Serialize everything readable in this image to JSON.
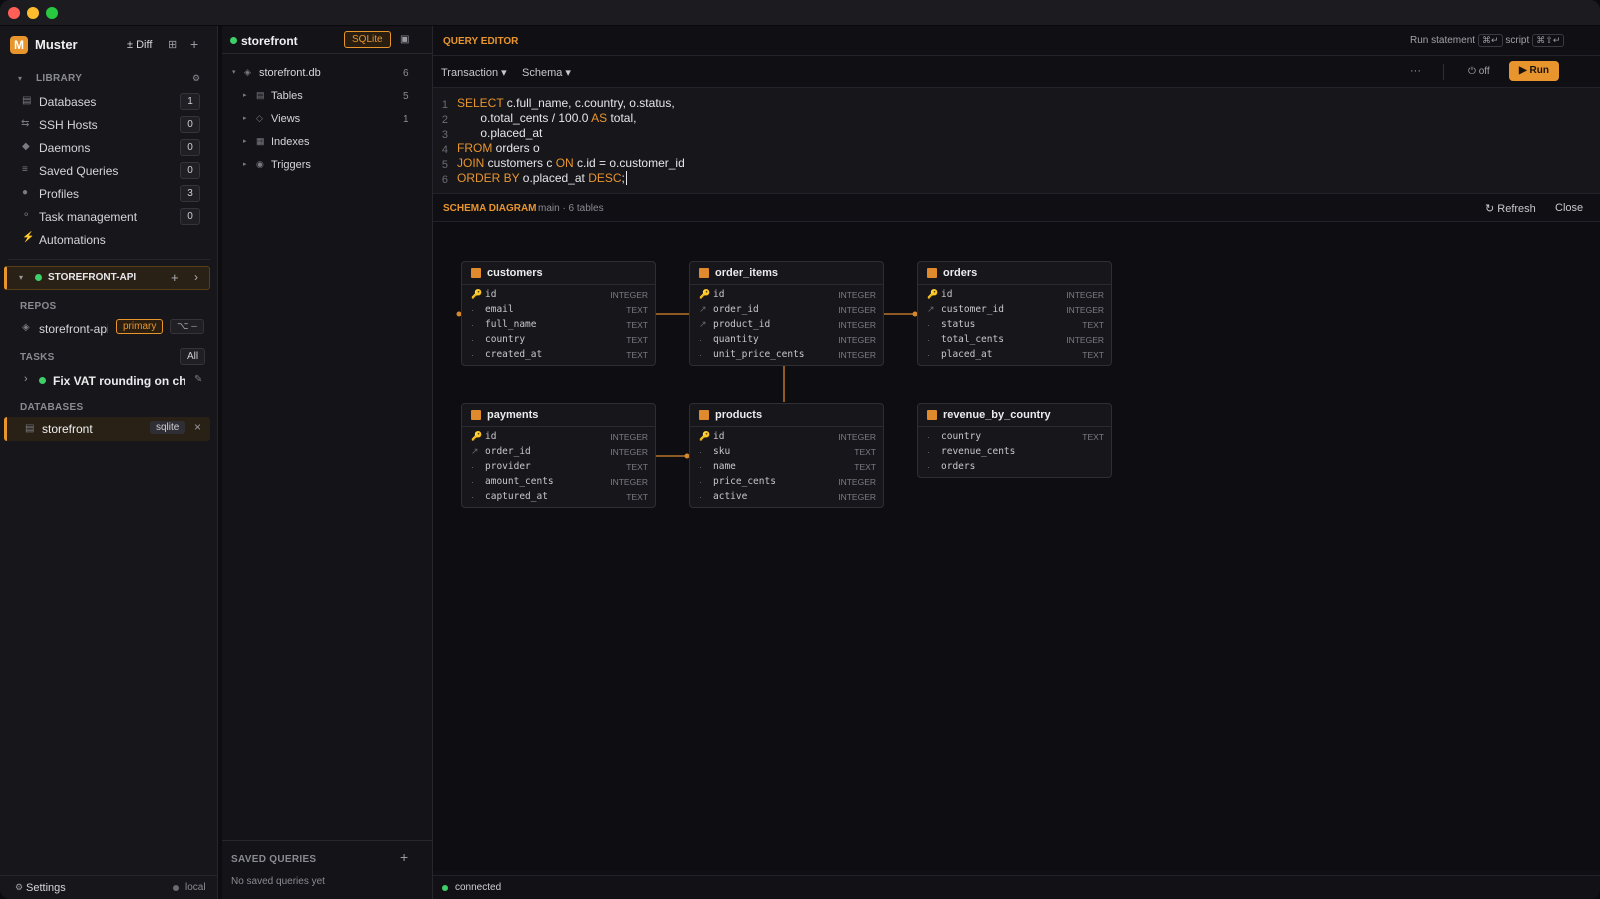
{
  "app": {
    "name": "Muster",
    "logo_letter": "M",
    "diff": "± Diff"
  },
  "library": {
    "title": "LIBRARY",
    "items": [
      {
        "label": "Databases",
        "count": "1"
      },
      {
        "label": "SSH Hosts",
        "count": "0"
      },
      {
        "label": "Daemons",
        "count": "0"
      },
      {
        "label": "Saved Queries",
        "count": "0"
      },
      {
        "label": "Profiles",
        "count": "3"
      },
      {
        "label": "Task management",
        "count": "0"
      },
      {
        "label": "Automations"
      }
    ]
  },
  "project": {
    "name": "STOREFRONT-API"
  },
  "repos": {
    "title": "REPOS",
    "name": "storefront-api",
    "badge": "primary",
    "branch_icon": "⌥ –"
  },
  "tasks": {
    "title": "TASKS",
    "filter": "All",
    "item": "Fix VAT rounding on checkout"
  },
  "databases": {
    "title": "DATABASES",
    "item": "storefront",
    "badge": "sqlite"
  },
  "footer": {
    "settings": "Settings",
    "local": "local"
  },
  "explorer": {
    "db_name": "storefront",
    "db_type": "SQLite",
    "file": "storefront.db",
    "file_count": "6",
    "nodes": [
      {
        "label": "Tables",
        "count": "5"
      },
      {
        "label": "Views",
        "count": "1"
      },
      {
        "label": "Indexes",
        "count": ""
      },
      {
        "label": "Triggers",
        "count": ""
      }
    ],
    "saved_title": "SAVED QUERIES",
    "saved_empty": "No saved queries yet"
  },
  "editor": {
    "title": "QUERY EDITOR",
    "run_statement": "Run statement",
    "kbd1": "⌘↵",
    "script": "script",
    "kbd2": "⌘⇧↵",
    "transaction": "Transaction ▾",
    "schema": "Schema ▾",
    "more": "···",
    "autocommit": "⏻ off",
    "run": "▶ Run",
    "line_numbers": [
      "1",
      "2",
      "3",
      "4",
      "5",
      "6"
    ]
  },
  "diagram": {
    "title": "SCHEMA DIAGRAM",
    "subtitle": "main · 6 tables",
    "refresh": "↻ Refresh",
    "close": "Close",
    "tables": [
      {
        "name": "customers",
        "cols": [
          [
            "id",
            "INTEGER",
            "k"
          ],
          [
            "email",
            "TEXT",
            ""
          ],
          [
            "full_name",
            "TEXT",
            ""
          ],
          [
            "country",
            "TEXT",
            ""
          ],
          [
            "created_at",
            "TEXT",
            ""
          ]
        ]
      },
      {
        "name": "order_items",
        "cols": [
          [
            "id",
            "INTEGER",
            "k"
          ],
          [
            "order_id",
            "INTEGER",
            "f"
          ],
          [
            "product_id",
            "INTEGER",
            "f"
          ],
          [
            "quantity",
            "INTEGER",
            ""
          ],
          [
            "unit_price_cents",
            "INTEGER",
            ""
          ]
        ]
      },
      {
        "name": "orders",
        "cols": [
          [
            "id",
            "INTEGER",
            "k"
          ],
          [
            "customer_id",
            "INTEGER",
            "f"
          ],
          [
            "status",
            "TEXT",
            ""
          ],
          [
            "total_cents",
            "INTEGER",
            ""
          ],
          [
            "placed_at",
            "TEXT",
            ""
          ]
        ]
      },
      {
        "name": "payments",
        "cols": [
          [
            "id",
            "INTEGER",
            "k"
          ],
          [
            "order_id",
            "INTEGER",
            "f"
          ],
          [
            "provider",
            "TEXT",
            ""
          ],
          [
            "amount_cents",
            "INTEGER",
            ""
          ],
          [
            "captured_at",
            "TEXT",
            ""
          ]
        ]
      },
      {
        "name": "products",
        "cols": [
          [
            "id",
            "INTEGER",
            "k"
          ],
          [
            "sku",
            "TEXT",
            ""
          ],
          [
            "name",
            "TEXT",
            ""
          ],
          [
            "price_cents",
            "INTEGER",
            ""
          ],
          [
            "active",
            "INTEGER",
            ""
          ]
        ]
      },
      {
        "name": "revenue_by_country",
        "cols": [
          [
            "country",
            "TEXT",
            ""
          ],
          [
            "revenue_cents",
            "",
            ""
          ],
          [
            "orders",
            "",
            ""
          ]
        ]
      }
    ]
  },
  "status": {
    "text": "connected"
  },
  "colors": {
    "accent": "#e8952e",
    "ok": "#3ecf6a"
  }
}
